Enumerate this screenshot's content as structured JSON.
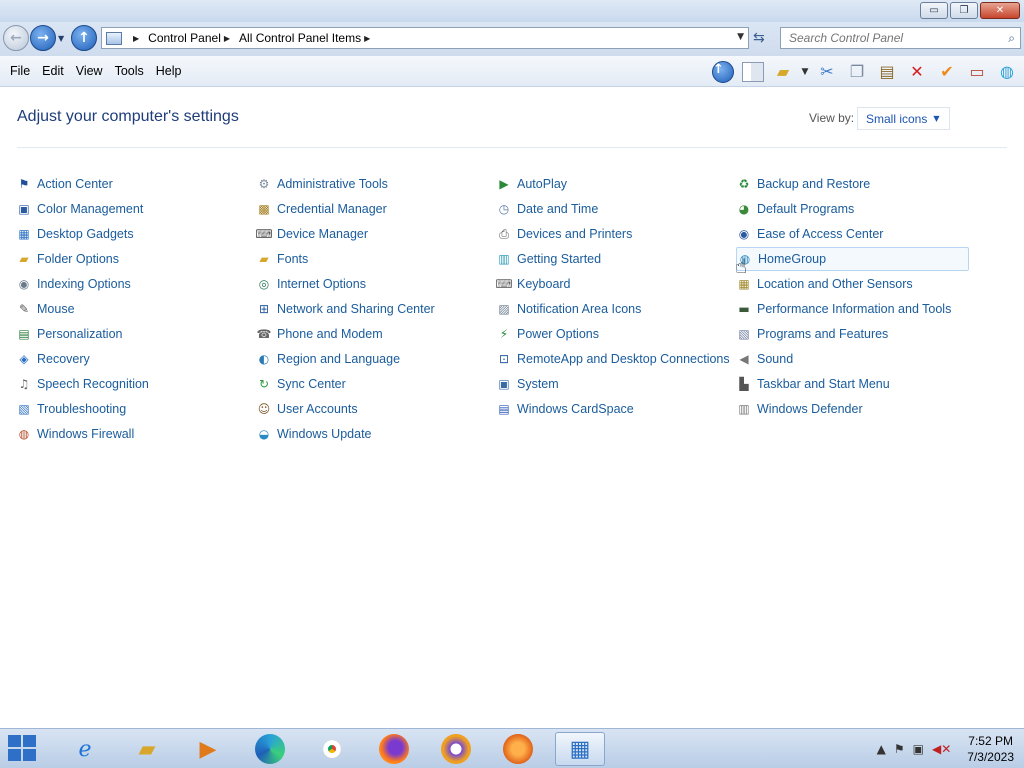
{
  "window": {
    "minimize_glyph": "▭",
    "restore_glyph": "❐",
    "close_glyph": "✕"
  },
  "address": {
    "crumbs": [
      "Control Panel",
      "All Control Panel Items"
    ],
    "search_placeholder": "Search Control Panel"
  },
  "menu": [
    "File",
    "Edit",
    "View",
    "Tools",
    "Help"
  ],
  "header": {
    "title": "Adjust your computer's settings",
    "view_by_label": "View by:",
    "view_by_value": "Small icons"
  },
  "items": [
    {
      "label": "Action Center",
      "icon": "⚑",
      "color": "#1f4f9a"
    },
    {
      "label": "Color Management",
      "icon": "▣",
      "color": "#2c5aa0"
    },
    {
      "label": "Desktop Gadgets",
      "icon": "▦",
      "color": "#2a6fc4"
    },
    {
      "label": "Folder Options",
      "icon": "▰",
      "color": "#d8a62a"
    },
    {
      "label": "Indexing Options",
      "icon": "◉",
      "color": "#6a7a8c"
    },
    {
      "label": "Mouse",
      "icon": "✎",
      "color": "#555555"
    },
    {
      "label": "Personalization",
      "icon": "▤",
      "color": "#2a7a3a"
    },
    {
      "label": "Recovery",
      "icon": "◈",
      "color": "#2a6fc4"
    },
    {
      "label": "Speech Recognition",
      "icon": "♫",
      "color": "#666666"
    },
    {
      "label": "Troubleshooting",
      "icon": "▧",
      "color": "#2a6fc4"
    },
    {
      "label": "Windows Firewall",
      "icon": "◍",
      "color": "#b44a2a"
    },
    {
      "label": "Administrative Tools",
      "icon": "⚙",
      "color": "#7a8a9c"
    },
    {
      "label": "Credential Manager",
      "icon": "▩",
      "color": "#a07a1a"
    },
    {
      "label": "Device Manager",
      "icon": "⌨",
      "color": "#555555"
    },
    {
      "label": "Fonts",
      "icon": "▰",
      "color": "#d8a62a"
    },
    {
      "label": "Internet Options",
      "icon": "◎",
      "color": "#2a7a5a"
    },
    {
      "label": "Network and Sharing Center",
      "icon": "⊞",
      "color": "#2a5aa0"
    },
    {
      "label": "Phone and Modem",
      "icon": "☎",
      "color": "#666666"
    },
    {
      "label": "Region and Language",
      "icon": "◐",
      "color": "#2a7ab4"
    },
    {
      "label": "Sync Center",
      "icon": "↻",
      "color": "#2a9a3a"
    },
    {
      "label": "User Accounts",
      "icon": "☺",
      "color": "#7a5a2a"
    },
    {
      "label": "Windows Update",
      "icon": "◒",
      "color": "#2a8ac4"
    },
    {
      "label": "AutoPlay",
      "icon": "▶",
      "color": "#2a8a3a"
    },
    {
      "label": "Date and Time",
      "icon": "◷",
      "color": "#5a7aa0"
    },
    {
      "label": "Devices and Printers",
      "icon": "⎙",
      "color": "#555555"
    },
    {
      "label": "Getting Started",
      "icon": "▥",
      "color": "#2a9ab4"
    },
    {
      "label": "Keyboard",
      "icon": "⌨",
      "color": "#666666"
    },
    {
      "label": "Notification Area Icons",
      "icon": "▨",
      "color": "#6a7a8c"
    },
    {
      "label": "Power Options",
      "icon": "⚡",
      "color": "#2a8a3a"
    },
    {
      "label": "RemoteApp and Desktop Connections",
      "icon": "⊡",
      "color": "#2a5aa0"
    },
    {
      "label": "System",
      "icon": "▣",
      "color": "#3a6aa4"
    },
    {
      "label": "Windows CardSpace",
      "icon": "▤",
      "color": "#2a5ab4"
    },
    {
      "label": "Backup and Restore",
      "icon": "♻",
      "color": "#2a8a3a"
    },
    {
      "label": "Default Programs",
      "icon": "◕",
      "color": "#3a8a3a"
    },
    {
      "label": "Ease of Access Center",
      "icon": "◉",
      "color": "#2a5aa0"
    },
    {
      "label": "HomeGroup",
      "icon": "◍",
      "color": "#2a8ac4"
    },
    {
      "label": "Location and Other Sensors",
      "icon": "▦",
      "color": "#a08a2a"
    },
    {
      "label": "Performance Information and Tools",
      "icon": "▬",
      "color": "#3a5a3a"
    },
    {
      "label": "Programs and Features",
      "icon": "▧",
      "color": "#6a7a9c"
    },
    {
      "label": "Sound",
      "icon": "◀",
      "color": "#777777"
    },
    {
      "label": "Taskbar and Start Menu",
      "icon": "▙",
      "color": "#555555"
    },
    {
      "label": "Windows Defender",
      "icon": "▥",
      "color": "#7a7a7a"
    }
  ],
  "taskbar": {
    "time": "7:52 PM",
    "date": "7/3/2023"
  }
}
